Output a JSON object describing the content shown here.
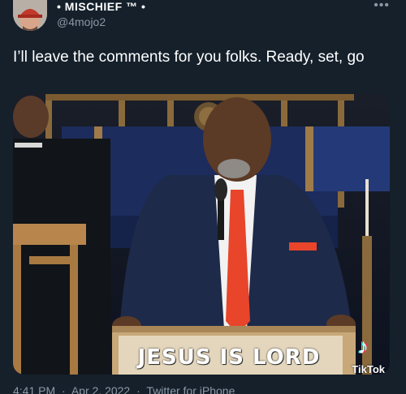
{
  "author": {
    "display_name": "• MISCHIEF ™ •",
    "handle": "@4mojo2"
  },
  "more_icon": "more-dots-icon",
  "tweet": {
    "text": "I’ll leave the comments for you folks. Ready, set, go"
  },
  "media": {
    "podium_sign": "JESUS IS LORD",
    "watermark": "TikTok"
  },
  "meta": {
    "time": "4:41 PM",
    "sep1": "·",
    "date": "Apr 2, 2022",
    "sep2": "·",
    "source": "Twitter for iPhone"
  },
  "colors": {
    "background": "#15202b",
    "secondary_text": "#8b98a5",
    "tie": "#e8452a"
  }
}
